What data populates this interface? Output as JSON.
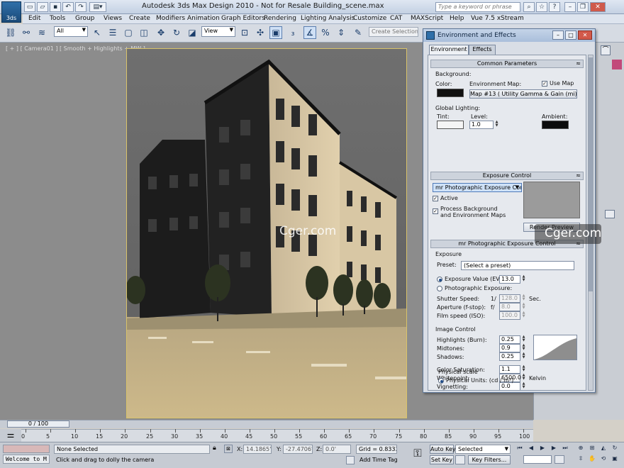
{
  "app": {
    "logo_text": "3ds",
    "title": "Autodesk 3ds Max Design 2010   -  Not for Resale    Building_scene.max",
    "search_placeholder": "Type a keyword or phrase"
  },
  "menu": [
    "Edit",
    "Tools",
    "Group",
    "Views",
    "Create",
    "Modifiers",
    "Animation",
    "Graph Editors",
    "Rendering",
    "Lighting Analysis",
    "Customize",
    "CAT",
    "MAXScript",
    "Help",
    "Vue 7.5 xStream"
  ],
  "toolbar": {
    "selection_filter": "All",
    "reference_coord": "View",
    "create_selection_set": "Create Selection Se"
  },
  "viewport": {
    "label": "[ + ] [ Camera01 ] [ Smooth + Highlights + MW ]"
  },
  "env_dialog": {
    "title": "Environment and Effects",
    "tabs": [
      "Environment",
      "Effects"
    ],
    "common": {
      "header": "Common Parameters",
      "background_label": "Background:",
      "color_label": "Color:",
      "env_map_label": "Environment Map:",
      "use_map_label": "Use Map",
      "map_button": "Map #13  ( Utility Gamma & Gain (mi) )",
      "global_lighting_label": "Global Lighting:",
      "tint_label": "Tint:",
      "level_label": "Level:",
      "level_value": "1.0",
      "ambient_label": "Ambient:",
      "color_hex": "#111111",
      "tint_hex": "#f5f5f5",
      "ambient_hex": "#0c0c0c"
    },
    "exposure_control": {
      "header": "Exposure Control",
      "dropdown": "mr Photographic Exposure Contro",
      "active_label": "Active",
      "process_label_1": "Process Background",
      "process_label_2": "and Environment Maps",
      "render_preview": "Render Preview"
    },
    "mr_photo": {
      "header": "mr Photographic Exposure Control",
      "exposure_label": "Exposure",
      "preset_label": "Preset:",
      "preset_value": "(Select a preset)",
      "ev_label": "Exposure Value (EV):",
      "ev_value": "13.0",
      "photo_exposure_label": "Photographic Exposure:",
      "shutter_label": "Shutter Speed:",
      "shutter_prefix": "1/",
      "shutter_value": "128.0",
      "shutter_unit": "Sec.",
      "aperture_label": "Aperture (f-stop):",
      "aperture_prefix": "f/",
      "aperture_value": "8.0",
      "film_label": "Film speed (ISO):",
      "film_value": "100.0",
      "image_control_label": "Image Control",
      "highlights_label": "Highlights (Burn):",
      "highlights_value": "0.25",
      "midtones_label": "Midtones:",
      "midtones_value": "0.9",
      "shadows_label": "Shadows:",
      "shadows_value": "0.25",
      "saturation_label": "Color Saturation:",
      "saturation_value": "1.1",
      "whitepoint_label": "Whitepoint:",
      "whitepoint_value": "6500.0",
      "whitepoint_unit": "Kelvin",
      "vignetting_label": "Vignetting:",
      "vignetting_value": "0.0",
      "physical_scale_label": "Physical scale",
      "physical_units_label": "Physical Units: (cd / m²)"
    }
  },
  "watermarks": [
    "Cger.com",
    "Cger.com"
  ],
  "timeline": {
    "frame_range": "0 / 100",
    "ticks": [
      "0",
      "5",
      "10",
      "15",
      "20",
      "25",
      "30",
      "35",
      "40",
      "45",
      "50",
      "55",
      "60",
      "65",
      "70",
      "75",
      "80",
      "85",
      "90",
      "95",
      "100"
    ]
  },
  "status": {
    "maxscript_listener": "Welcome to M",
    "selection_info": "None Selected",
    "prompt": "Click and drag to dolly the camera",
    "x_label": "X:",
    "x_value": "14.1865'",
    "y_label": "Y:",
    "y_value": "-27.4706'",
    "z_label": "Z:",
    "z_value": "0.0'",
    "grid": "Grid = 0.8333'",
    "add_time_tag": "Add Time Tag",
    "auto_key": "Auto Key",
    "set_key": "Set Key",
    "key_mode": "Selected",
    "key_filters": "Key Filters..."
  }
}
